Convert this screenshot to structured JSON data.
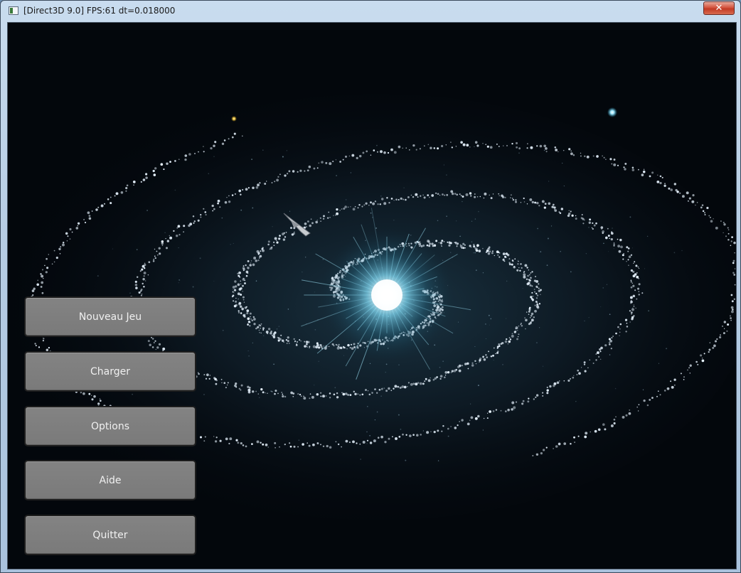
{
  "window": {
    "title": "[Direct3D 9.0] FPS:61 dt=0.018000",
    "close_label": "✕"
  },
  "menu": {
    "buttons": [
      {
        "id": "new-game",
        "label": "Nouveau Jeu"
      },
      {
        "id": "load",
        "label": "Charger"
      },
      {
        "id": "options",
        "label": "Options"
      },
      {
        "id": "help",
        "label": "Aide"
      },
      {
        "id": "quit",
        "label": "Quitter"
      }
    ]
  },
  "scene": {
    "background_color": "#03070c",
    "core_color": "#bff0ff",
    "arm_color": "#e8f4ff"
  }
}
